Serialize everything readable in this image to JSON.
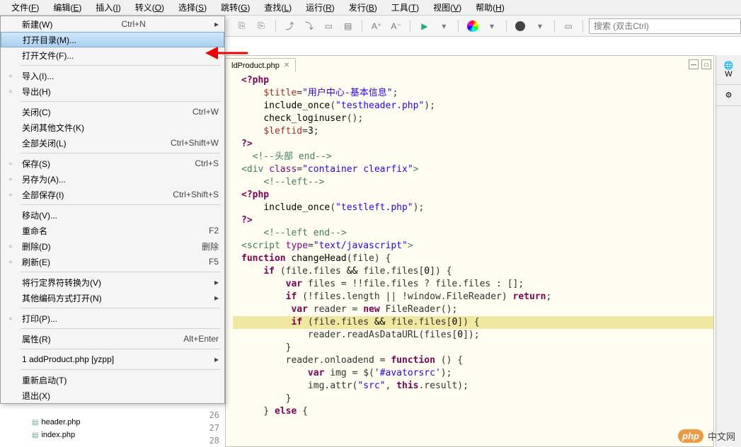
{
  "menubar": [
    {
      "label": "文件",
      "accel": "F"
    },
    {
      "label": "编辑",
      "accel": "E"
    },
    {
      "label": "插入",
      "accel": "I"
    },
    {
      "label": "转义",
      "accel": "O"
    },
    {
      "label": "选择",
      "accel": "S"
    },
    {
      "label": "跳转",
      "accel": "G"
    },
    {
      "label": "查找",
      "accel": "L"
    },
    {
      "label": "运行",
      "accel": "R"
    },
    {
      "label": "发行",
      "accel": "B"
    },
    {
      "label": "工具",
      "accel": "T"
    },
    {
      "label": "视图",
      "accel": "V"
    },
    {
      "label": "帮助",
      "accel": "H"
    }
  ],
  "toolbar": {
    "search_placeholder": "搜索 (双击Ctrl)"
  },
  "file_menu": {
    "items": [
      {
        "label": "新建(W)",
        "shortcut": "Ctrl+N",
        "arrow": true,
        "icon": ""
      },
      {
        "label": "打开目录(M)...",
        "highlighted": true,
        "icon": ""
      },
      {
        "label": "打开文件(F)...",
        "icon": ""
      },
      {
        "sep": true
      },
      {
        "label": "导入(I)...",
        "icon": "import"
      },
      {
        "label": "导出(H)",
        "icon": "export"
      },
      {
        "sep": true
      },
      {
        "label": "关闭(C)",
        "shortcut": "Ctrl+W"
      },
      {
        "label": "关闭其他文件(K)"
      },
      {
        "label": "全部关闭(L)",
        "shortcut": "Ctrl+Shift+W"
      },
      {
        "sep": true
      },
      {
        "label": "保存(S)",
        "shortcut": "Ctrl+S",
        "icon": "save"
      },
      {
        "label": "另存为(A)...",
        "icon": "saveas"
      },
      {
        "label": "全部保存(I)",
        "shortcut": "Ctrl+Shift+S",
        "icon": "saveall"
      },
      {
        "sep": true
      },
      {
        "label": "移动(V)..."
      },
      {
        "label": "重命名",
        "shortcut": "F2"
      },
      {
        "label": "删除(D)",
        "shortcut": "删除",
        "icon": "delete"
      },
      {
        "label": "刷新(E)",
        "shortcut": "F5",
        "icon": "refresh"
      },
      {
        "sep": true
      },
      {
        "label": "将行定界符转换为(V)",
        "arrow": true
      },
      {
        "label": "其他编码方式打开(N)",
        "arrow": true
      },
      {
        "sep": true
      },
      {
        "label": "打印(P)...",
        "icon": "print"
      },
      {
        "sep": true
      },
      {
        "label": "属性(R)",
        "shortcut": "Alt+Enter"
      },
      {
        "sep": true
      },
      {
        "label": "1 addProduct.php  [yzpp]",
        "arrow": true
      },
      {
        "sep": true
      },
      {
        "label": "重新启动(T)"
      },
      {
        "label": "退出(X)"
      }
    ]
  },
  "editor": {
    "tab_name": "ldProduct.php",
    "tab_close": "✕"
  },
  "code_lines": [
    {
      "html": "<span class='kw'>&lt;?php</span>"
    },
    {
      "html": "    <span class='var'>$title</span>=<span class='str'>\"用户中心-基本信息\"</span>;"
    },
    {
      "html": "    <span class='fn'>include_once</span>(<span class='str'>\"testheader.php\"</span>);"
    },
    {
      "html": "    <span class='fn'>check_loginuser</span>();"
    },
    {
      "html": "    <span class='var'>$leftid</span>=<span class='num'>3</span>;"
    },
    {
      "html": "<span class='kw'>?&gt;</span>"
    },
    {
      "html": "  <span class='cmt'>&lt;!--头部 end--&gt;</span>"
    },
    {
      "html": "<span class='tag'>&lt;div</span> <span class='attr'>class</span>=<span class='str'>\"container clearfix\"</span><span class='tag'>&gt;</span>"
    },
    {
      "html": "    <span class='cmt'>&lt;!--left--&gt;</span>"
    },
    {
      "html": "<span class='kw'>&lt;?php</span>"
    },
    {
      "html": "    <span class='fn'>include_once</span>(<span class='str'>\"testleft.php\"</span>);"
    },
    {
      "html": "<span class='kw'>?&gt;</span>"
    },
    {
      "html": "    <span class='cmt'>&lt;!--left end--&gt;</span>"
    },
    {
      "html": "<span class='tag'>&lt;script</span> <span class='attr'>type</span>=<span class='str'>\"text/javascript\"</span><span class='tag'>&gt;</span>"
    },
    {
      "html": ""
    },
    {
      "html": "<span class='kw'>function</span> <span class='fn'>changeHead</span>(file) {"
    },
    {
      "html": "    <span class='kw'>if</span> (file.files <span class='op'>&amp;&amp;</span> file.files[<span class='num'>0</span>]) {"
    },
    {
      "html": "        <span class='kw'>var</span> files = !!file.files ? file.files : [];"
    },
    {
      "html": "        <span class='kw'>if</span> (!files.length || !window.FileReader) <span class='kw'>return</span>;"
    },
    {
      "html": "         <span class='kw'>var</span> reader = <span class='kw'>new</span> FileReader();"
    },
    {
      "html": "         <span class='kw'>if</span> (file.files <span class='op'>&amp;&amp;</span> file.files[<span class='num'>0</span>]) {",
      "hl": true
    },
    {
      "html": "            reader.readAsDataURL(files[<span class='num'>0</span>]);"
    },
    {
      "html": "        }"
    },
    {
      "html": "        reader.onloadend = <span class='kw'>function</span> () {"
    },
    {
      "html": "            <span class='kw'>var</span> img = $(<span class='str'>'#avatorsrc'</span>);"
    },
    {
      "html": "            img.attr(<span class='str'>\"src\"</span>, <span class='kw'>this</span>.result);"
    },
    {
      "html": "        }"
    },
    {
      "html": "    } <span class='kw'>else</span> {"
    }
  ],
  "gutter_lines": [
    "26",
    "27",
    "28"
  ],
  "sidebar_files": [
    {
      "name": "header.php",
      "icon": "php"
    },
    {
      "name": "index.php",
      "icon": "php"
    }
  ],
  "right_tabs": [
    "W"
  ],
  "watermark": {
    "logo": "php",
    "text": "中文网"
  }
}
